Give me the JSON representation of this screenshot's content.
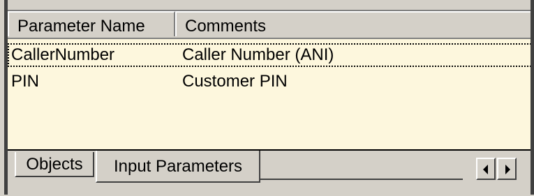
{
  "grid": {
    "columns": [
      "Parameter Name",
      "Comments"
    ],
    "rows": [
      {
        "name": "CallerNumber",
        "comment": "Caller Number (ANI)",
        "selected": true
      },
      {
        "name": "PIN",
        "comment": "Customer PIN",
        "selected": false
      }
    ],
    "background_color": "#fdf7dd"
  },
  "tabs": [
    {
      "label": "Objects",
      "active": false
    },
    {
      "label": "Input Parameters",
      "active": true
    }
  ],
  "scroll": {
    "left_icon": "arrow-left-icon",
    "right_icon": "arrow-right-icon"
  }
}
